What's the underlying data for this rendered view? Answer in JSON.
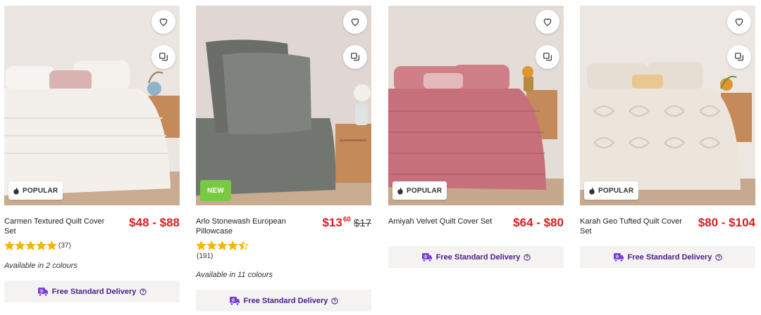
{
  "products": [
    {
      "name": "Carmen Textured Quilt Cover Set",
      "price": "$48 - $88",
      "badge": "POPULAR",
      "rating_value": 5,
      "rating_count": "(37)",
      "colours": "Available in 2 colours",
      "delivery": "Free Standard Delivery",
      "scene": {
        "wall": "#ebe6e2",
        "bed": "#f3f0ec",
        "pillow": "#d9b3b2",
        "floor": "#c9ab8f"
      }
    },
    {
      "name": "Arlo Stonewash European Pillowcase",
      "price_whole": "$13",
      "price_cents": "60",
      "price_was": "$17",
      "badge": "NEW",
      "rating_value": 4.5,
      "rating_count": "(191)",
      "colours": "Available in 11 colours",
      "delivery": "Free Standard Delivery",
      "scene": {
        "wall": "#e0d7d5",
        "bed": "#727671",
        "pillow": "#6a6d68",
        "floor": "#c9ab8f"
      }
    },
    {
      "name": "Amiyah Velvet Quilt Cover Set",
      "price": "$64 - $80",
      "badge": "POPULAR",
      "delivery": "Free Standard Delivery",
      "scene": {
        "wall": "#e4dcd6",
        "bed": "#c6707b",
        "pillow": "#d07f88",
        "floor": "#c6a88c"
      }
    },
    {
      "name": "Karah Geo Tufted Quilt Cover Set",
      "price": "$80 - $104",
      "badge": "POPULAR",
      "delivery": "Free Standard Delivery",
      "scene": {
        "wall": "#ece7e2",
        "bed": "#ebe5dc",
        "pillow": "#e8c88e",
        "floor": "#c6a98e"
      }
    }
  ],
  "icons": {
    "wishlist": "heart-icon",
    "compare": "compare-icon",
    "popular": "flame-icon",
    "delivery": "truck-icon",
    "help": "help-icon",
    "star": "star-icon"
  },
  "colors": {
    "price": "#d12023",
    "delivery_text": "#4a1d8a",
    "star": "#f2b705",
    "new_badge": "#7ac943"
  }
}
